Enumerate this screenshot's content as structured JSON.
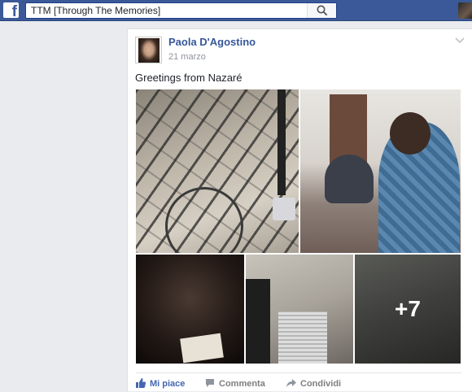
{
  "topbar": {
    "logo_letter": "f",
    "search_value": "TTM [Through The Memories]",
    "search_icon": "search-icon"
  },
  "post": {
    "author": "Paola D'Agostino",
    "date": "21 marzo",
    "text": "Greetings from Nazaré",
    "more_photos": "+7",
    "photos": [
      "photo-beach-chairs",
      "photo-room-reading",
      "photo-writing-dark",
      "photo-laptop-desk",
      "photo-more"
    ]
  },
  "actions": {
    "like": "Mi piace",
    "comment": "Commenta",
    "share": "Condividi"
  },
  "colors": {
    "brand": "#3b5998",
    "link": "#365899",
    "like_accent": "#4267b2"
  }
}
